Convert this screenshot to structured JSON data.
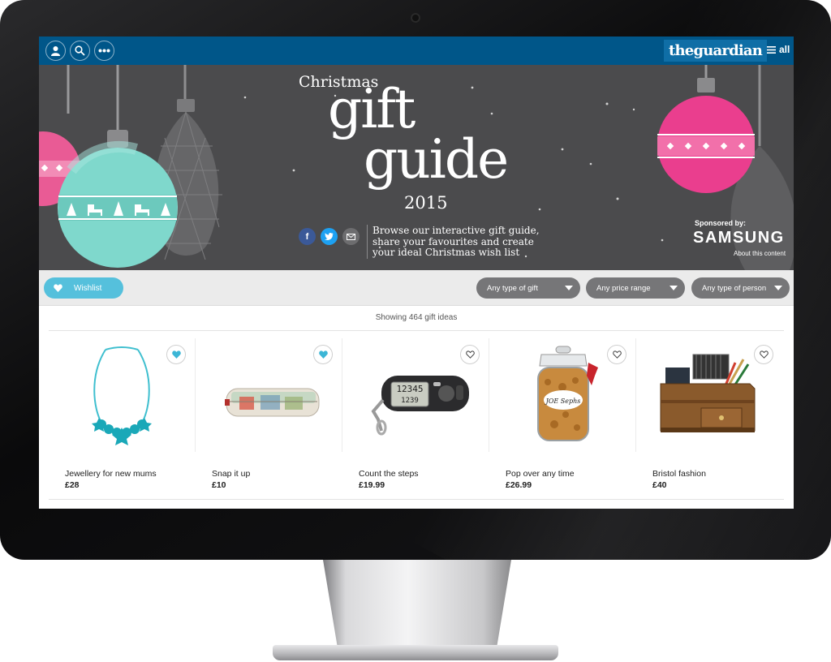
{
  "colors": {
    "nav_blue": "#005689",
    "hero_bg": "#4b4b4d",
    "wishlist_teal": "#55c0dc",
    "filter_grey": "#767678",
    "ornament_teal": "#7fd8cc",
    "ornament_pink": "#ea3e8e"
  },
  "topbar": {
    "icons": [
      "profile-icon",
      "search-icon",
      "more-icon"
    ],
    "logo": "theguardian",
    "menu_label": "all"
  },
  "hero": {
    "title_prefix": "Christmas",
    "title_line1": "gift",
    "title_line2": "guide",
    "year": "2015",
    "share_icons": [
      "facebook-icon",
      "twitter-icon",
      "email-icon"
    ],
    "share_facebook": "f",
    "description": "Browse our interactive gift guide, share your favourites and create your ideal Christmas wish list",
    "sponsor_label": "Sponsored by:",
    "sponsor_name": "SAMSUNG",
    "sponsor_link": "About this content"
  },
  "filters": {
    "wishlist_label": "Wishlist",
    "gift_type": "Any type of gift",
    "price_range": "Any price range",
    "person_type": "Any type of person"
  },
  "results": {
    "showing_text": "Showing 464 gift ideas"
  },
  "products": [
    {
      "title": "Jewellery for new mums",
      "price": "£28",
      "favourited": true
    },
    {
      "title": "Snap it up",
      "price": "£10",
      "favourited": true
    },
    {
      "title": "Count the steps",
      "price": "£19.99",
      "favourited": false
    },
    {
      "title": "Pop over any time",
      "price": "£26.99",
      "favourited": false
    },
    {
      "title": "Bristol fashion",
      "price": "£40",
      "favourited": false
    }
  ],
  "product_image_text": {
    "pedometer_display": "12345",
    "pedometer_display2": "1239",
    "jar_label": "JOE Sephs"
  }
}
